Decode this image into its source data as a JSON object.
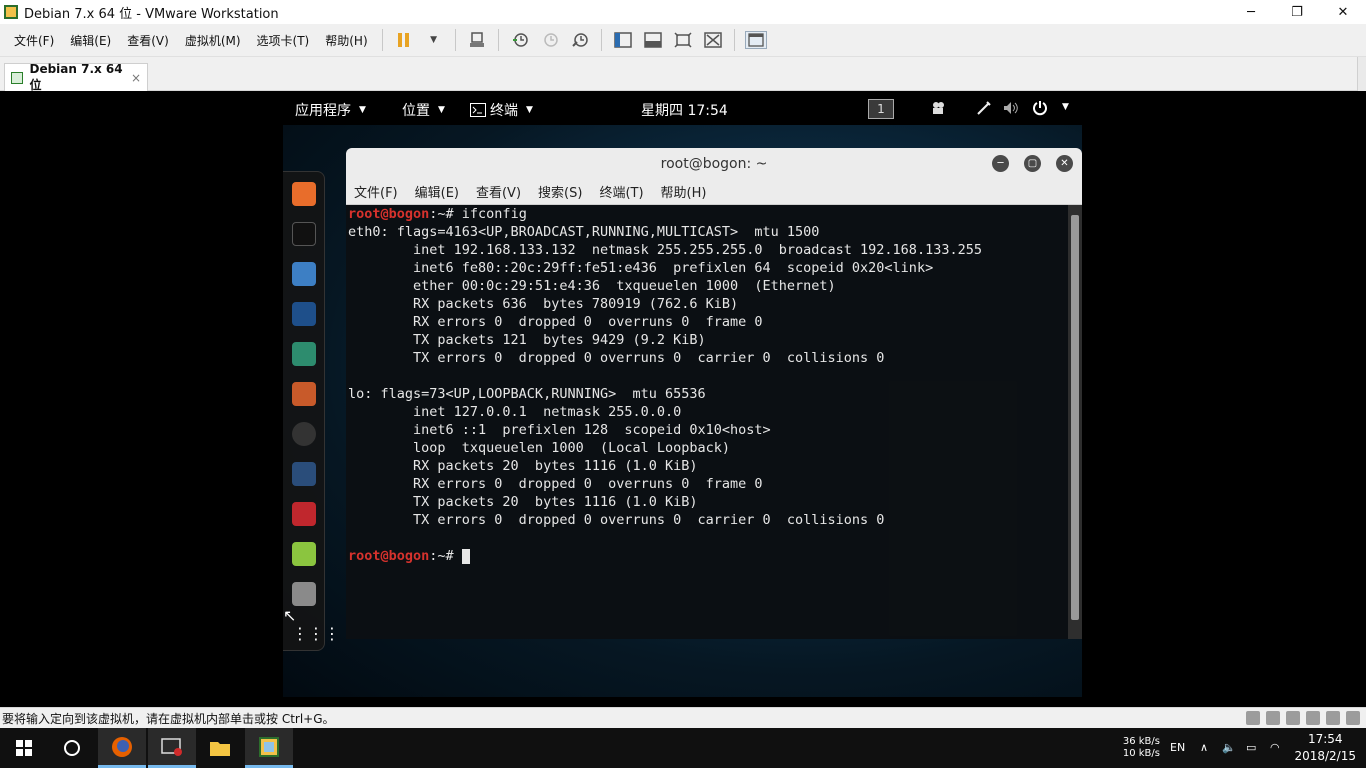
{
  "window": {
    "title": "Debian 7.x 64 位 - VMware Workstation"
  },
  "menubar": [
    "文件(F)",
    "编辑(E)",
    "查看(V)",
    "虚拟机(M)",
    "选项卡(T)",
    "帮助(H)"
  ],
  "tabs": [
    {
      "label": "Debian 7.x 64 位",
      "close": "×"
    }
  ],
  "guest": {
    "topbar": {
      "apps": "应用程序",
      "places": "位置",
      "terminal": "终端",
      "clock": "星期四 17:54",
      "workspace": "1"
    },
    "terminal": {
      "title": "root@bogon: ~",
      "menu": [
        "文件(F)",
        "编辑(E)",
        "查看(V)",
        "搜索(S)",
        "终端(T)",
        "帮助(H)"
      ],
      "prompt_user": "root@bogon",
      "prompt_suffix": ":~# ",
      "command": "ifconfig",
      "output": [
        "eth0: flags=4163<UP,BROADCAST,RUNNING,MULTICAST>  mtu 1500",
        "        inet 192.168.133.132  netmask 255.255.255.0  broadcast 192.168.133.255",
        "        inet6 fe80::20c:29ff:fe51:e436  prefixlen 64  scopeid 0x20<link>",
        "        ether 00:0c:29:51:e4:36  txqueuelen 1000  (Ethernet)",
        "        RX packets 636  bytes 780919 (762.6 KiB)",
        "        RX errors 0  dropped 0  overruns 0  frame 0",
        "        TX packets 121  bytes 9429 (9.2 KiB)",
        "        TX errors 0  dropped 0 overruns 0  carrier 0  collisions 0",
        "",
        "lo: flags=73<UP,LOOPBACK,RUNNING>  mtu 65536",
        "        inet 127.0.0.1  netmask 255.0.0.0",
        "        inet6 ::1  prefixlen 128  scopeid 0x10<host>",
        "        loop  txqueuelen 1000  (Local Loopback)",
        "        RX packets 20  bytes 1116 (1.0 KiB)",
        "        RX errors 0  dropped 0  overruns 0  frame 0",
        "        TX packets 20  bytes 1116 (1.0 KiB)",
        "        TX errors 0  dropped 0 overruns 0  carrier 0  collisions 0",
        ""
      ]
    }
  },
  "statusbar": {
    "message": "要将输入定向到该虚拟机，请在虚拟机内部单击或按 Ctrl+G。"
  },
  "taskbar": {
    "net_up": "36 kB/s",
    "net_down": "10 kB/s",
    "ime": "EN",
    "time": "17:54",
    "date": "2018/2/15"
  },
  "colors": {
    "prompt": "#d6322d",
    "accent": "#76b9ed"
  }
}
